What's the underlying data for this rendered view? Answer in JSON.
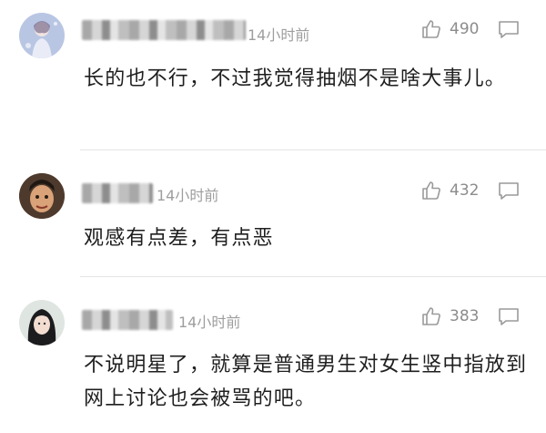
{
  "comments": [
    {
      "username": "",
      "time": "14小时前",
      "likes": "490",
      "text": "长的也不行，不过我觉得抽烟不是啥大事儿。"
    },
    {
      "username": "",
      "time": "14小时前",
      "likes": "432",
      "text": "观感有点差，有点恶"
    },
    {
      "username": "",
      "time": "14小时前",
      "likes": "383",
      "text": "不说明星了，就算是普通男生对女生竖中指放到网上讨论也会被骂的吧。"
    }
  ],
  "icons": {
    "like": "thumbs-up-icon",
    "reply": "comment-bubble-icon"
  },
  "colors": {
    "meta_text": "#9e9e9e",
    "body_text": "#1f1f1f",
    "divider": "#e4e4e4"
  }
}
